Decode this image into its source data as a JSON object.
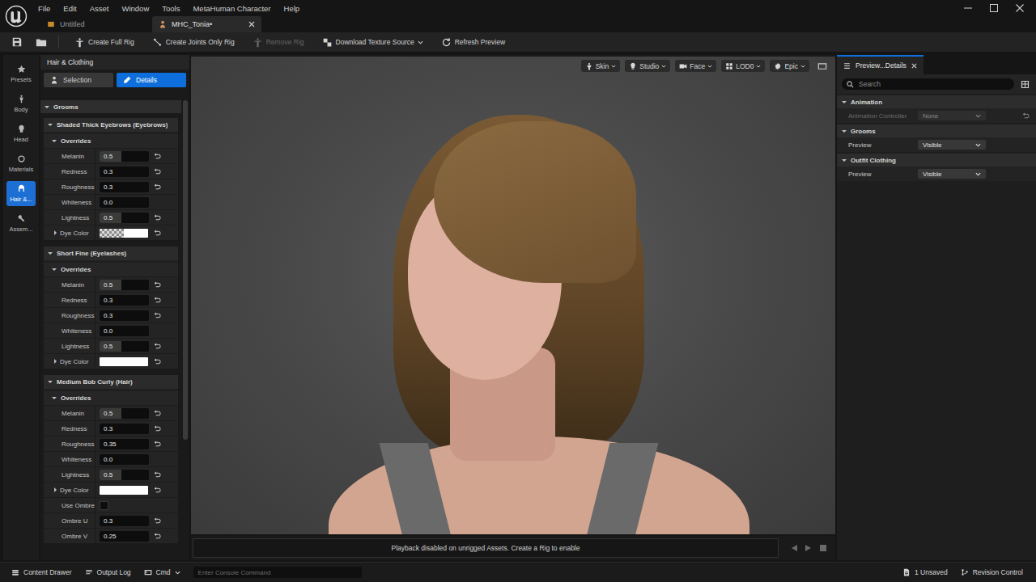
{
  "window": {
    "menu": [
      "File",
      "Edit",
      "Asset",
      "Window",
      "Tools",
      "MetaHuman Character",
      "Help"
    ]
  },
  "document_tabs": [
    {
      "label": "Untitled",
      "selected": false,
      "closable": false
    },
    {
      "label": "MHC_Tonia•",
      "selected": true,
      "closable": true
    }
  ],
  "toolbar": [
    {
      "label": "Create Full Rig",
      "disabled": false,
      "dropdown": false
    },
    {
      "label": "Create Joints Only Rig",
      "disabled": false,
      "dropdown": false
    },
    {
      "label": "Remove Rig",
      "disabled": true,
      "dropdown": false
    },
    {
      "label": "Download Texture Source",
      "disabled": false,
      "dropdown": true
    },
    {
      "label": "Refresh Preview",
      "disabled": false,
      "dropdown": false
    }
  ],
  "sidebar": [
    {
      "label": "Presets",
      "selected": false
    },
    {
      "label": "Body",
      "selected": false
    },
    {
      "label": "Head",
      "selected": false
    },
    {
      "label": "Materials",
      "selected": false
    },
    {
      "label": "Hair &...",
      "selected": true
    },
    {
      "label": "Assem...",
      "selected": false
    }
  ],
  "panel": {
    "title": "Hair & Clothing",
    "tabs": [
      {
        "label": "Selection",
        "selected": false
      },
      {
        "label": "Details",
        "selected": true
      }
    ],
    "section": {
      "title": "Grooms",
      "expanded": true
    },
    "grooms": [
      {
        "name": "Shaded Thick Eyebrows (Eyebrows)",
        "expanded": true,
        "overrides": {
          "title": "Overrides",
          "expanded": true
        },
        "props": [
          {
            "kind": "slider",
            "label": "Melanin",
            "value": "0.5",
            "level": 0.45,
            "reset": true
          },
          {
            "kind": "slider",
            "label": "Redness",
            "value": "0.3",
            "level": 0,
            "reset": true
          },
          {
            "kind": "slider",
            "label": "Roughness",
            "value": "0.3",
            "level": 0,
            "reset": true
          },
          {
            "kind": "slider",
            "label": "Whiteness",
            "value": "0.0",
            "level": 0,
            "reset": false
          },
          {
            "kind": "slider",
            "label": "Lightness",
            "value": "0.5",
            "level": 0.45,
            "reset": true
          },
          {
            "kind": "color",
            "label": "Dye Color",
            "color": "#ffffff",
            "checker": true,
            "expanded": false,
            "reset": true
          }
        ]
      },
      {
        "name": "Short Fine (Eyelashes)",
        "expanded": true,
        "overrides": {
          "title": "Overrides",
          "expanded": true
        },
        "props": [
          {
            "kind": "slider",
            "label": "Melanin",
            "value": "0.5",
            "level": 0.45,
            "reset": true
          },
          {
            "kind": "slider",
            "label": "Redness",
            "value": "0.3",
            "level": 0,
            "reset": true
          },
          {
            "kind": "slider",
            "label": "Roughness",
            "value": "0.3",
            "level": 0,
            "reset": true
          },
          {
            "kind": "slider",
            "label": "Whiteness",
            "value": "0.0",
            "level": 0,
            "reset": false
          },
          {
            "kind": "slider",
            "label": "Lightness",
            "value": "0.5",
            "level": 0.45,
            "reset": true
          },
          {
            "kind": "color",
            "label": "Dye Color",
            "color": "#ffffff",
            "checker": false,
            "expanded": false,
            "reset": true
          }
        ]
      },
      {
        "name": "Medium Bob Curly (Hair)",
        "expanded": true,
        "overrides": {
          "title": "Overrides",
          "expanded": true
        },
        "props": [
          {
            "kind": "slider",
            "label": "Melanin",
            "value": "0.5",
            "level": 0.45,
            "reset": true
          },
          {
            "kind": "slider",
            "label": "Redness",
            "value": "0.3",
            "level": 0,
            "reset": true
          },
          {
            "kind": "slider",
            "label": "Roughness",
            "value": "0.35",
            "level": 0,
            "reset": true
          },
          {
            "kind": "slider",
            "label": "Whiteness",
            "value": "0.0",
            "level": 0,
            "reset": false
          },
          {
            "kind": "slider",
            "label": "Lightness",
            "value": "0.5",
            "level": 0.45,
            "reset": true
          },
          {
            "kind": "color",
            "label": "Dye Color",
            "color": "#ffffff",
            "checker": false,
            "expanded": false,
            "reset": true
          },
          {
            "kind": "checkbox",
            "label": "Use Ombre",
            "checked": false,
            "reset": false
          },
          {
            "kind": "slider",
            "label": "Ombre U",
            "value": "0.3",
            "level": 0,
            "reset": true
          },
          {
            "kind": "slider",
            "label": "Ombre V",
            "value": "0.25",
            "level": 0,
            "reset": true
          }
        ]
      }
    ]
  },
  "viewport": {
    "toolbar": [
      {
        "label": "Skin"
      },
      {
        "label": "Studio"
      },
      {
        "label": "Face"
      },
      {
        "label": "LOD0"
      },
      {
        "label": "Epic"
      }
    ],
    "message": "Playback disabled on unrigged Assets. Create a Rig to enable"
  },
  "details": {
    "title": "Preview...Details",
    "search_placeholder": "Search",
    "sections": [
      {
        "title": "Animation",
        "expanded": true,
        "rows": [
          {
            "label": "Animation Controller",
            "value": "None",
            "disabled": true,
            "reset": true
          }
        ]
      },
      {
        "title": "Grooms",
        "expanded": true,
        "rows": [
          {
            "label": "Preview",
            "value": "Visible",
            "disabled": false,
            "reset": false
          }
        ]
      },
      {
        "title": "Outfit Clothing",
        "expanded": true,
        "rows": [
          {
            "label": "Preview",
            "value": "Visible",
            "disabled": false,
            "reset": false
          }
        ]
      }
    ]
  },
  "status_bar": {
    "left": [
      {
        "label": "Content Drawer",
        "dropdown": false
      },
      {
        "label": "Output Log",
        "dropdown": false
      },
      {
        "label": "Cmd",
        "dropdown": true
      }
    ],
    "console_placeholder": "Enter Console Command",
    "right": [
      {
        "label": "1 Unsaved"
      },
      {
        "label": "Revision Control"
      }
    ]
  }
}
